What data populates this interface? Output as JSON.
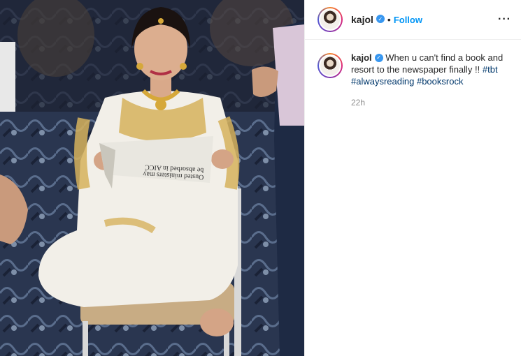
{
  "post": {
    "author": {
      "username": "kajol",
      "verified": true,
      "follow_label": "Follow",
      "separator": "•"
    },
    "more_icon": "more-options-icon",
    "caption": {
      "username": "kajol",
      "text": "When u can't find a book and resort to the newspaper finally !!",
      "hashtags": [
        "#tbt",
        "#alwaysreading",
        "#booksrock"
      ]
    },
    "timestamp": "22h"
  },
  "photo": {
    "newspaper_headline_1": "be absorbed in AICC",
    "newspaper_headline_2": "Ousted ministers may"
  },
  "colors": {
    "follow": "#0095f6",
    "hashtag": "#00376b",
    "verified": "#3897f0",
    "muted": "#8e8e8e"
  }
}
